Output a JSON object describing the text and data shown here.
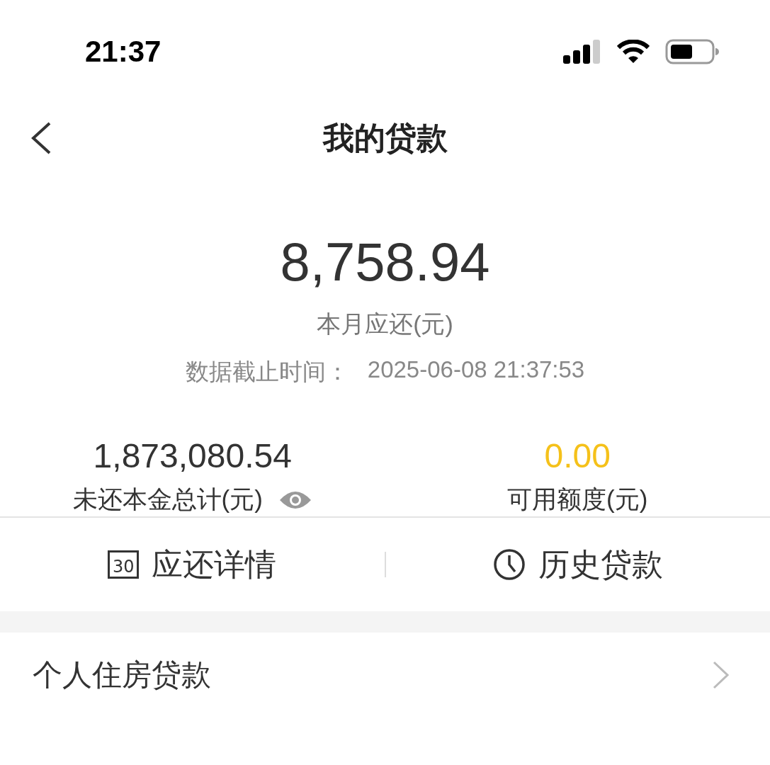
{
  "status_bar": {
    "time": "21:37"
  },
  "nav": {
    "title": "我的贷款"
  },
  "summary": {
    "amount": "8,758.94",
    "amount_label": "本月应还(元)",
    "updated_label": "数据截止时间：",
    "updated_time": "2025-06-08 21:37:53"
  },
  "stats": [
    {
      "value": "1,873,080.54",
      "label": "未还本金总计(元)",
      "highlight": false,
      "eye": true
    },
    {
      "value": "0.00",
      "label": "可用额度(元)",
      "highlight": true,
      "eye": false
    }
  ],
  "actions": [
    {
      "kind": "calendar",
      "icon_text": "30",
      "label": "应还详情"
    },
    {
      "kind": "clock",
      "label": "历史贷款"
    }
  ],
  "loans": [
    {
      "label": "个人住房贷款"
    }
  ]
}
